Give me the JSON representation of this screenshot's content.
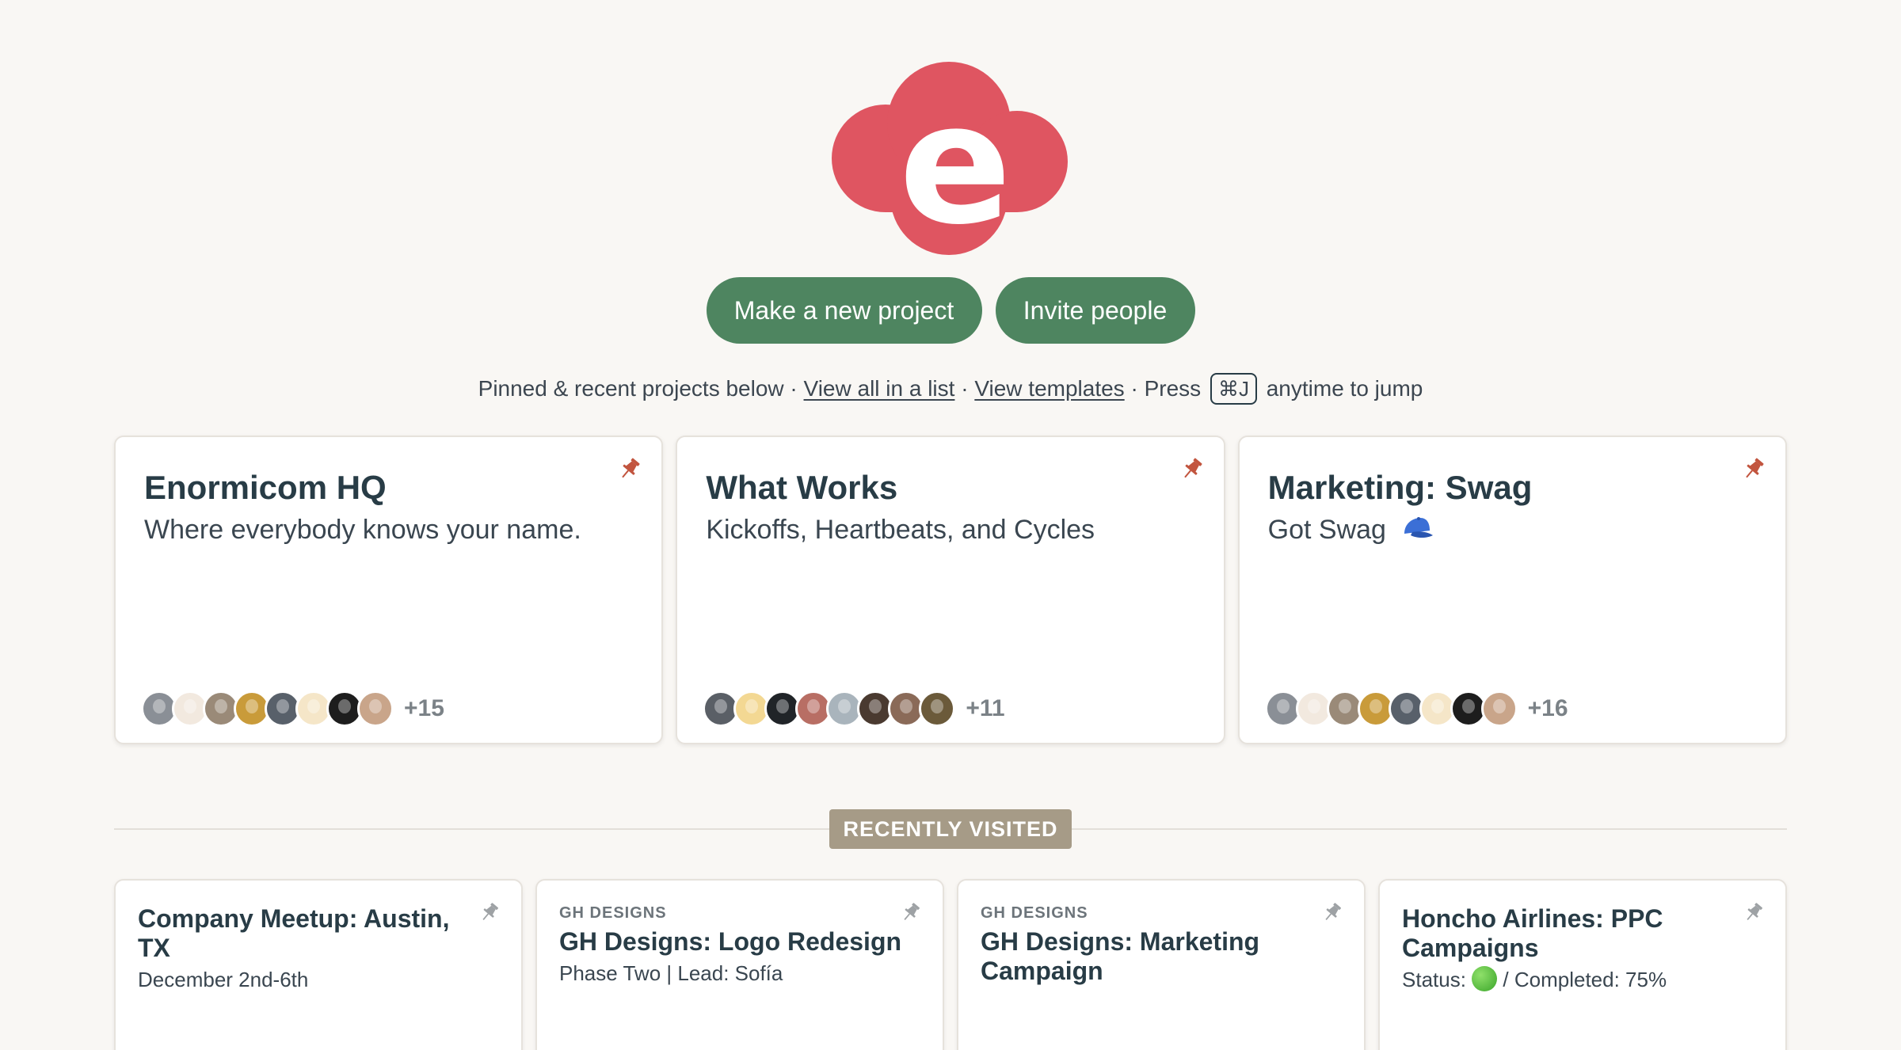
{
  "brand": {
    "logo_letter": "e",
    "logo_color": "#df5561",
    "logo_name": "basecamp-logo"
  },
  "actions": {
    "new_project": "Make a new project",
    "invite": "Invite people",
    "button_color": "#4e8560"
  },
  "subline": {
    "intro": "Pinned & recent projects below ·",
    "view_all": "View all in a list",
    "sep": "·",
    "view_templates": "View templates",
    "press": "· Press",
    "shortcut": "⌘J",
    "tail": "anytime to jump"
  },
  "pinned": [
    {
      "title": "Enormicom HQ",
      "description": "Where everybody knows your name.",
      "more": "+15",
      "avatars": [
        "#8a8f96",
        "#f2e9df",
        "#9a8a78",
        "#c99b3a",
        "#58606a",
        "#f5e6c8",
        "#1d1d1d",
        "#c9a58a"
      ]
    },
    {
      "title": "What Works",
      "description": "Kickoffs, Heartbeats, and Cycles",
      "more": "+11",
      "avatars": [
        "#5a5f66",
        "#f3d893",
        "#202428",
        "#b86e64",
        "#a9b4bc",
        "#4a3a30",
        "#8a6a58",
        "#6b5a3a"
      ]
    },
    {
      "title": "Marketing: Swag",
      "description": "Got Swag",
      "more": "+16",
      "avatars": [
        "#8a8f96",
        "#f2e9df",
        "#9a8a78",
        "#c99b3a",
        "#58606a",
        "#f5e6c8",
        "#1d1d1d",
        "#c9a58a"
      ]
    }
  ],
  "section_label": "RECENTLY VISITED",
  "recent": [
    {
      "eyebrow": "",
      "title": "Company Meetup: Austin, TX",
      "description": "December 2nd-6th"
    },
    {
      "eyebrow": "GH DESIGNS",
      "title": "GH Designs: Logo Redesign",
      "description": "Phase Two | Lead: Sofía"
    },
    {
      "eyebrow": "GH DESIGNS",
      "title": "GH Designs: Marketing Campaign",
      "description": ""
    },
    {
      "eyebrow": "",
      "title": "Honcho Airlines: PPC Campaigns",
      "status_label": "Status:",
      "status_tail": "/ Completed: 75%"
    }
  ],
  "icons": {
    "pin_active": "pin-icon",
    "pin_color_active": "#c2553f",
    "pin_color_inactive": "#9ea2a5",
    "swag": "cap-icon",
    "status": "green-circle-icon"
  }
}
